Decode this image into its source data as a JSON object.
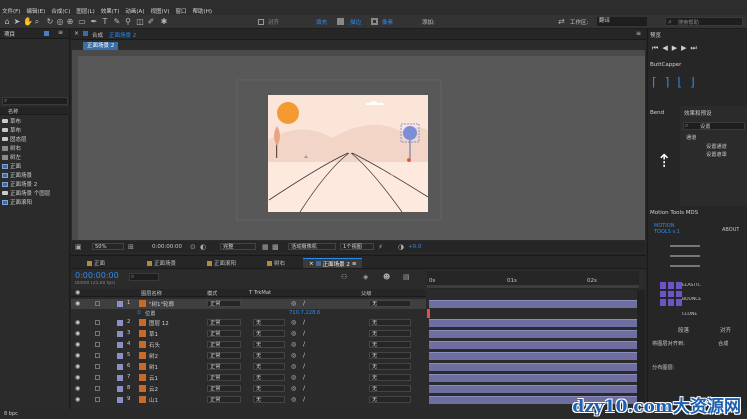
{
  "menu": [
    "文件(F)",
    "编辑(E)",
    "合成(C)",
    "图层(L)",
    "效果(T)",
    "动画(A)",
    "视图(V)",
    "窗口",
    "帮助(H)"
  ],
  "toolbar": {
    "snap_label": "对齐",
    "fill_label": "填充",
    "stroke_label": "描边",
    "stroke_unit": "像素",
    "add_label": "添加:",
    "workspace_label": "工作区:",
    "workspace_value": "翻译",
    "search_placeholder": "搜索帮助"
  },
  "project": {
    "title": "项目",
    "column_name": "名称",
    "items": [
      {
        "label": "草布",
        "kind": "folder"
      },
      {
        "label": "草布",
        "kind": "folder"
      },
      {
        "label": "固态层",
        "kind": "folder"
      },
      {
        "label": "树右",
        "kind": "img"
      },
      {
        "label": "树左",
        "kind": "img"
      },
      {
        "label": "正面",
        "kind": "comp"
      },
      {
        "label": "正面场景",
        "kind": "comp"
      },
      {
        "label": "正面场景 2",
        "kind": "comp"
      },
      {
        "label": "正面场景 个固层",
        "kind": "folder"
      },
      {
        "label": "正面滚阳",
        "kind": "comp"
      }
    ]
  },
  "comp": {
    "tab_label": "合成",
    "tab_name": "正面场景 2",
    "sub_tab": "正面场景 2",
    "zoom": "50%",
    "timecode": "0:00:00:00",
    "resolution": "完整",
    "camera": "活动摄像机",
    "views": "1个视图",
    "exposure": "+0.0"
  },
  "timeline": {
    "tabs": [
      "正面",
      "正面场景",
      "正面滚阳",
      "树右",
      "正面场景 2"
    ],
    "active_tab": "正面场景 2",
    "timecode": "0:00:00:00",
    "frame_info": "00000 (25.00 fps)",
    "headers": {
      "layer_name": "图层名称",
      "mode": "模式",
      "trkmat": "T TrkMat",
      "parent": "父级"
    },
    "ruler": [
      "0s",
      "01s",
      "02s"
    ],
    "position_value": "710.7,228.6",
    "position_label": "位置",
    "layers": [
      {
        "num": "1",
        "name": "\"树1\"轮廓",
        "mode": "正常",
        "trk": "",
        "parent": "无",
        "selected": true
      },
      {
        "num": "2",
        "name": "图层 12",
        "mode": "正常",
        "trk": "无",
        "parent": "无"
      },
      {
        "num": "3",
        "name": "草1",
        "mode": "正常",
        "trk": "无",
        "parent": "无"
      },
      {
        "num": "4",
        "name": "石头",
        "mode": "正常",
        "trk": "无",
        "parent": "无"
      },
      {
        "num": "5",
        "name": "树2",
        "mode": "正常",
        "trk": "无",
        "parent": "无"
      },
      {
        "num": "6",
        "name": "树1",
        "mode": "正常",
        "trk": "无",
        "parent": "无"
      },
      {
        "num": "7",
        "name": "云1",
        "mode": "正常",
        "trk": "无",
        "parent": "无"
      },
      {
        "num": "8",
        "name": "云2",
        "mode": "正常",
        "trk": "无",
        "parent": "无"
      },
      {
        "num": "9",
        "name": "山1",
        "mode": "正常",
        "trk": "无",
        "parent": "无"
      }
    ],
    "bit_depth": "8 bpc"
  },
  "right": {
    "preview_title": "预览",
    "buttcapper_title": "ButtCapper",
    "bend_title": "Bend",
    "effects_title": "效果和预设",
    "effects_search": "设置",
    "effects_folder": "通道",
    "effects_items": [
      "设置通道",
      "设置遮罩"
    ],
    "mds_title": "Motion Tools MDS",
    "mds_logo": "MOTION\nTOOLS v.1",
    "about": "ABOUT",
    "elastic": "ELASTIC",
    "bounce": "BOUNCE",
    "clone": "CLONE",
    "bottom_tab1": "段落",
    "bottom_tab2": "对齐",
    "align_to_label": "将图层对齐到:",
    "align_to_value": "合成",
    "distribute_label": "分布图层:"
  },
  "watermark": "dzy10.com大资源网",
  "colors": {
    "accent": "#2d8ceb",
    "selected_tab": "#3a6ea5",
    "bar": "#6e6fa0",
    "timecode": "#2d8ceb",
    "sun": "#f39a33",
    "canvas_bg": "#fbe4d8"
  }
}
